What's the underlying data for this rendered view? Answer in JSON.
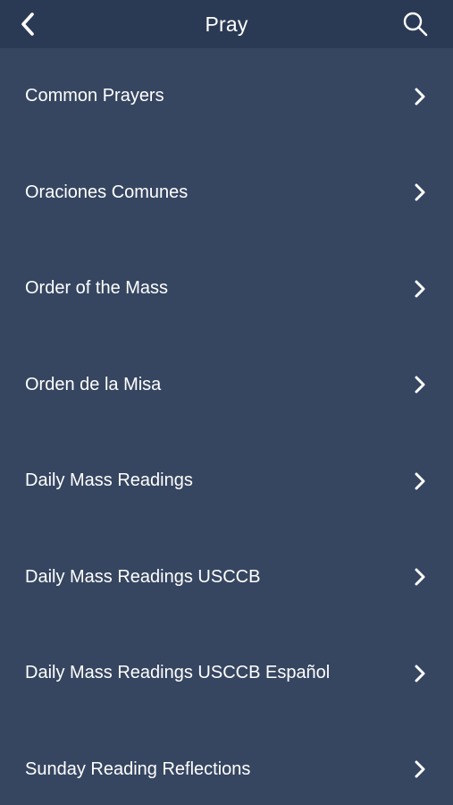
{
  "header": {
    "title": "Pray",
    "back_icon": "chevron-left-icon",
    "search_icon": "search-icon"
  },
  "menu": {
    "items": [
      {
        "label": "Common Prayers"
      },
      {
        "label": "Oraciones Comunes"
      },
      {
        "label": "Order of the Mass"
      },
      {
        "label": "Orden de la Misa"
      },
      {
        "label": "Daily Mass Readings"
      },
      {
        "label": "Daily Mass Readings USCCB"
      },
      {
        "label": "Daily Mass Readings USCCB Español"
      },
      {
        "label": "Sunday Reading Reflections"
      }
    ]
  },
  "colors": {
    "background": "#364661",
    "header": "#2b3a54",
    "text": "#ffffff"
  }
}
